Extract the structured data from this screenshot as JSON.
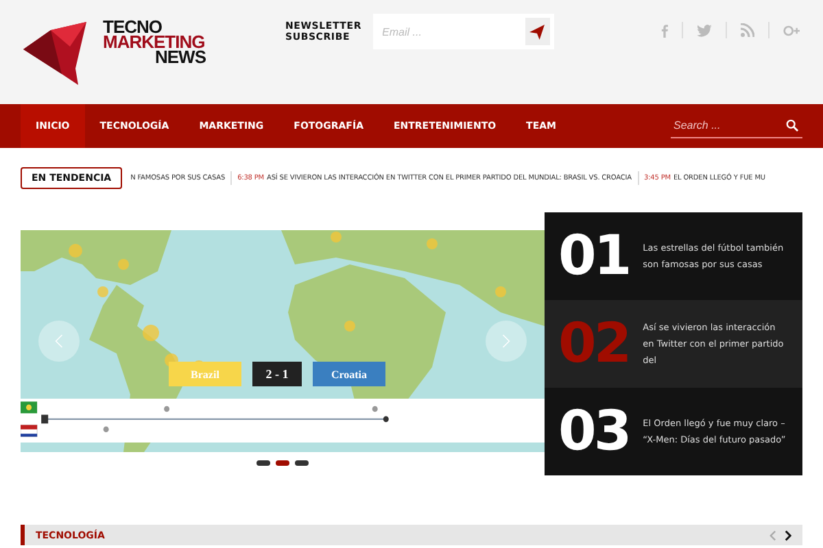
{
  "logo": {
    "line_1": "TECNO",
    "line_2": "MARKETING",
    "line_3": "NEWS"
  },
  "newsletter": {
    "label_1": "NEWSLETTER",
    "label_2": "SUBSCRIBE",
    "placeholder": "Email ..."
  },
  "nav": {
    "items": [
      {
        "label": "INICIO",
        "selected": true
      },
      {
        "label": "TECNOLOGÍA",
        "selected": false
      },
      {
        "label": "MARKETING",
        "selected": false
      },
      {
        "label": "FOTOGRAFÍA",
        "selected": false
      },
      {
        "label": "ENTRETENIMIENTO",
        "selected": false
      },
      {
        "label": "TEAM",
        "selected": false
      }
    ],
    "search_placeholder": "Search ..."
  },
  "ticker": {
    "label": "EN TENDENCIA",
    "items": [
      {
        "title": "N FAMOSAS POR SUS CASAS"
      },
      {
        "time": "6:38 PM",
        "title": "ASÍ SE VIVIERON LAS INTERACCIÓN EN TWITTER CON EL PRIMER PARTIDO DEL MUNDIAL: BRASIL VS. CROACIA"
      },
      {
        "time": "3:45 PM",
        "title": "EL ORDEN LLEGÓ Y FUE MU"
      }
    ]
  },
  "slider": {
    "home_team": "Brazil",
    "score": "2 - 1",
    "away_team": "Croatia",
    "dots": [
      {
        "selected": false
      },
      {
        "selected": true
      },
      {
        "selected": false
      }
    ]
  },
  "featured": [
    {
      "number": "01",
      "title": "Las estrellas del fútbol también son famosas por sus casas",
      "selected": false
    },
    {
      "number": "02",
      "title": "Así se vivieron las interacción en Twitter con el primer partido del",
      "selected": true
    },
    {
      "number": "03",
      "title": "El Orden llegó y fue muy claro – “X-Men: Días del futuro pasado”",
      "selected": false
    }
  ],
  "section": {
    "title": "TECNOLOGÍA"
  }
}
